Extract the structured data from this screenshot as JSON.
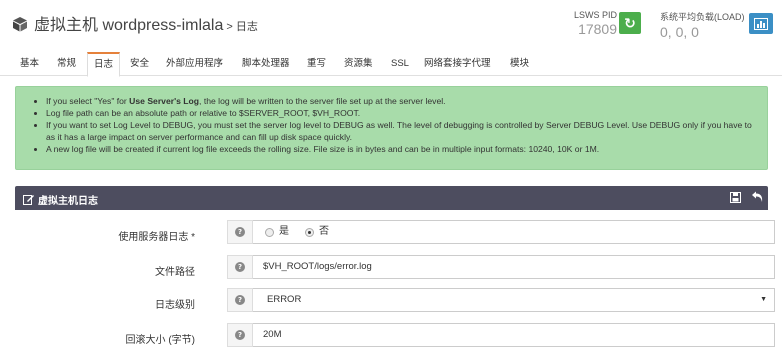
{
  "header": {
    "title": "虚拟主机 wordpress-imlala",
    "crumb": "> 日志",
    "pid_label": "LSWS PID",
    "pid_value": "17809",
    "load_label": "系统平均负载(LOAD)",
    "load_value": "0, 0, 0"
  },
  "tabs": [
    {
      "label": "基本"
    },
    {
      "label": "常规"
    },
    {
      "label": "日志"
    },
    {
      "label": "安全"
    },
    {
      "label": "外部应用程序"
    },
    {
      "label": "脚本处理器"
    },
    {
      "label": "重写"
    },
    {
      "label": "资源集"
    },
    {
      "label": "SSL"
    },
    {
      "label": "网络套接字代理"
    },
    {
      "label": "模块"
    }
  ],
  "info": {
    "line1_pre": "If you select \"Yes\" for ",
    "line1_bold": "Use Server's Log",
    "line1_post": ", the log will be written to the server file set up at the server level.",
    "line2": "Log file path can be an absolute path or relative to $SERVER_ROOT, $VH_ROOT.",
    "line3": "If you want to set Log Level to DEBUG, you must set the server log level to DEBUG as well. The level of debugging is controlled by Server DEBUG Level. Use DEBUG only if you have to as it has a large impact on server performance and can fill up disk space quickly.",
    "line4": "A new log file will be created if current log file exceeds the rolling size. File size is in bytes and can be in multiple input formats: 10240, 10K or 1M."
  },
  "panel": {
    "title": "虚拟主机日志"
  },
  "form": {
    "use_server_log_label": "使用服务器日志 *",
    "yes_label": "是",
    "no_label": "否",
    "selected": "no",
    "file_path_label": "文件路径",
    "file_path_value": "$VH_ROOT/logs/error.log",
    "log_level_label": "日志级别",
    "log_level_value": "ERROR",
    "rolling_size_label": "回滚大小 (字节)",
    "rolling_size_value": "20M"
  },
  "colors": {
    "active_tab_accent": "#e5813b",
    "refresh_button": "#4cae4c",
    "chart_button": "#3b8fc5",
    "info_bg": "#a8dcaa",
    "panel_header": "#4d4d5f"
  }
}
